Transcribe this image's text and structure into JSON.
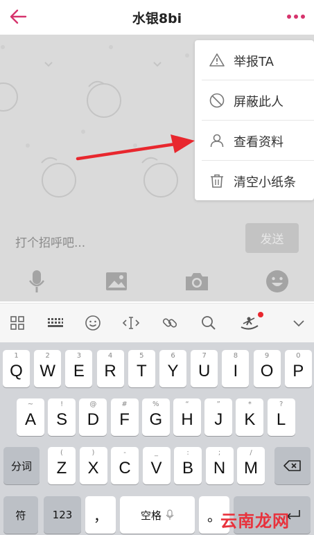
{
  "header": {
    "title": "水银8bi",
    "back_icon": "arrow-left-icon",
    "more_icon": "more-dots-icon",
    "accent": "#d6336c"
  },
  "chat": {
    "input_placeholder": "打个招呼吧...",
    "send_label": "发送"
  },
  "menu": {
    "items": [
      {
        "label": "举报TA",
        "icon": "warning-icon"
      },
      {
        "label": "屏蔽此人",
        "icon": "block-icon"
      },
      {
        "label": "查看资料",
        "icon": "person-icon"
      },
      {
        "label": "清空小纸条",
        "icon": "trash-icon"
      }
    ]
  },
  "keyboard": {
    "row1": [
      {
        "k": "Q",
        "s": "1"
      },
      {
        "k": "W",
        "s": "2"
      },
      {
        "k": "E",
        "s": "3"
      },
      {
        "k": "R",
        "s": "4"
      },
      {
        "k": "T",
        "s": "5"
      },
      {
        "k": "Y",
        "s": "6"
      },
      {
        "k": "U",
        "s": "7"
      },
      {
        "k": "I",
        "s": "8"
      },
      {
        "k": "O",
        "s": "9"
      },
      {
        "k": "P",
        "s": "0"
      }
    ],
    "row2": [
      {
        "k": "A",
        "s": "~"
      },
      {
        "k": "S",
        "s": "!"
      },
      {
        "k": "D",
        "s": "@"
      },
      {
        "k": "F",
        "s": "#"
      },
      {
        "k": "G",
        "s": "%"
      },
      {
        "k": "H",
        "s": "“"
      },
      {
        "k": "J",
        "s": "”"
      },
      {
        "k": "K",
        "s": "*"
      },
      {
        "k": "L",
        "s": "?"
      }
    ],
    "row3": [
      {
        "k": "Z",
        "s": "("
      },
      {
        "k": "X",
        "s": ")"
      },
      {
        "k": "C",
        "s": "-"
      },
      {
        "k": "V",
        "s": "_"
      },
      {
        "k": "B",
        "s": ":"
      },
      {
        "k": "N",
        "s": ";"
      },
      {
        "k": "M",
        "s": "/"
      }
    ],
    "fenci_label": "分词",
    "symbol_label": "符",
    "num_label": "123",
    "comma_label": "，",
    "space_label": "空格",
    "period_label": "。"
  },
  "watermark": "云南龙网"
}
